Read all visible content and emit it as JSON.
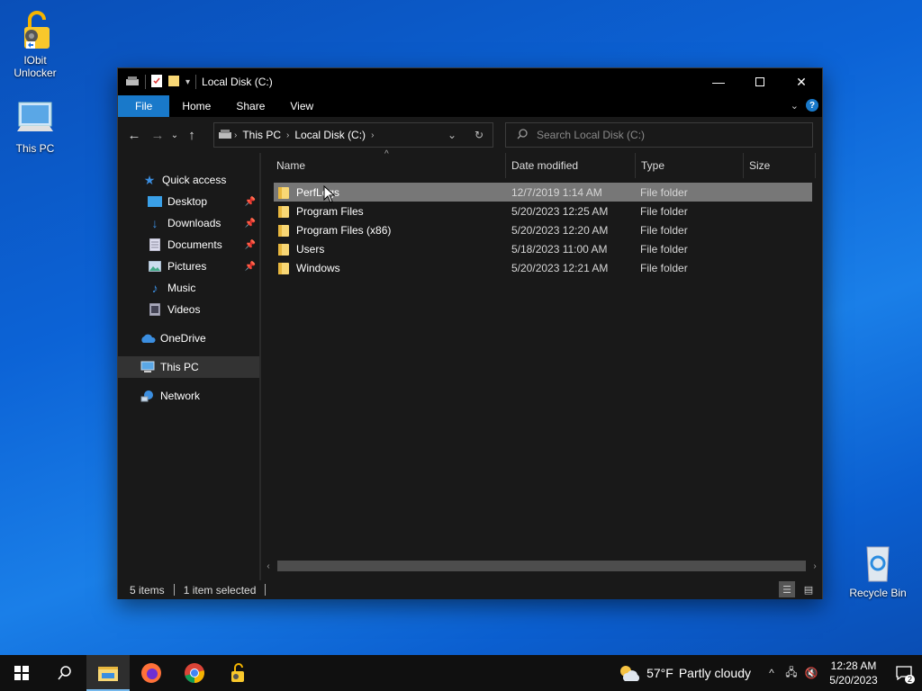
{
  "desktop": {
    "icons": [
      {
        "label_l1": "IObit",
        "label_l2": "Unlocker"
      },
      {
        "label": "This PC"
      },
      {
        "label": "Recycle Bin"
      }
    ]
  },
  "window": {
    "title": "Local Disk (C:)",
    "ribbon_tabs": [
      "File",
      "Home",
      "Share",
      "View"
    ],
    "breadcrumb": [
      "This PC",
      "Local Disk (C:)"
    ],
    "search_placeholder": "Search Local Disk (C:)",
    "nav": [
      {
        "label": "Quick access",
        "icon": "star-icon"
      },
      {
        "label": "Desktop",
        "icon": "desktop-folder-icon",
        "pinned": true
      },
      {
        "label": "Downloads",
        "icon": "download-icon",
        "pinned": true
      },
      {
        "label": "Documents",
        "icon": "documents-icon",
        "pinned": true
      },
      {
        "label": "Pictures",
        "icon": "pictures-icon",
        "pinned": true
      },
      {
        "label": "Music",
        "icon": "music-icon"
      },
      {
        "label": "Videos",
        "icon": "videos-icon"
      },
      {
        "label": "OneDrive",
        "icon": "cloud-icon"
      },
      {
        "label": "This PC",
        "icon": "computer-icon",
        "selected": true
      },
      {
        "label": "Network",
        "icon": "network-icon"
      }
    ],
    "columns": [
      "Name",
      "Date modified",
      "Type",
      "Size"
    ],
    "files": [
      {
        "name": "PerfLogs",
        "date": "12/7/2019 1:14 AM",
        "type": "File folder",
        "selected": true
      },
      {
        "name": "Program Files",
        "date": "5/20/2023 12:25 AM",
        "type": "File folder"
      },
      {
        "name": "Program Files (x86)",
        "date": "5/20/2023 12:20 AM",
        "type": "File folder"
      },
      {
        "name": "Users",
        "date": "5/18/2023 11:00 AM",
        "type": "File folder"
      },
      {
        "name": "Windows",
        "date": "5/20/2023 12:21 AM",
        "type": "File folder"
      }
    ],
    "status": {
      "count": "5 items",
      "selected": "1 item selected"
    }
  },
  "taskbar": {
    "weather": {
      "temp": "57°F",
      "desc": "Partly cloudy"
    },
    "time": "12:28 AM",
    "date": "5/20/2023",
    "notifications": "2"
  },
  "colors": {
    "accent": "#1979ca",
    "selection": "#777777",
    "folder": "#f8d775"
  }
}
